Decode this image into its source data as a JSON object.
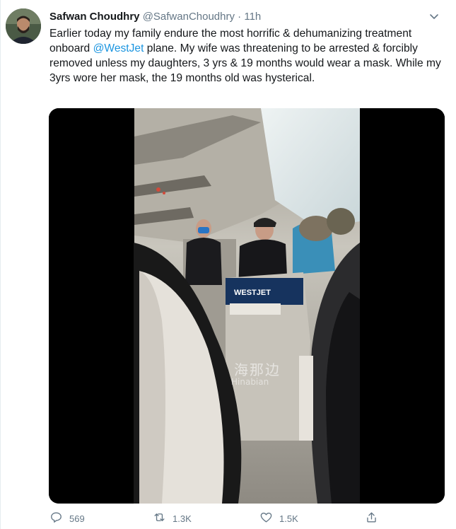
{
  "tweet": {
    "author": {
      "display_name": "Safwan Choudhry",
      "handle": "@SafwanChoudhry",
      "separator": "·",
      "time": "11h"
    },
    "text": {
      "part1": "Earlier today my family endure the most horrific & dehumanizing treatment onboard ",
      "mention": "@WestJet",
      "part2": " plane. My wife was threatening to be arrested & forcibly removed unless my daughters, 3 yrs & 19 months would wear a mask. While my 3yrs wore her mask, the 19 months old was hysterical."
    },
    "media": {
      "seatback_brand": "WESTJET",
      "watermark_cn": "海那边",
      "watermark_en": "Hinabian"
    },
    "actions": {
      "replies": "569",
      "retweets": "1.3K",
      "likes": "1.5K"
    }
  },
  "icons": {
    "caret": "chevron-down-icon",
    "reply": "reply-icon",
    "retweet": "retweet-icon",
    "like": "heart-icon",
    "share": "share-icon"
  },
  "colors": {
    "link": "#1b95e0",
    "secondary": "#657786",
    "text": "#14171a"
  }
}
